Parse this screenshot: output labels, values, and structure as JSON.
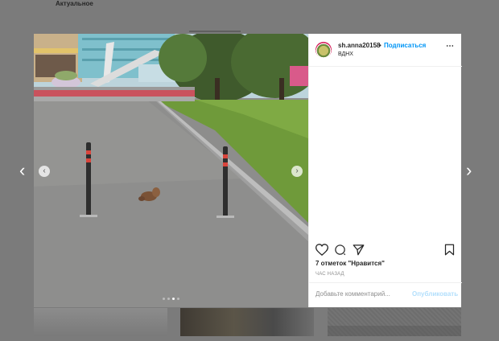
{
  "background": {
    "section_heading": "Актуальное"
  },
  "post": {
    "username": "sh.anna20158",
    "separator": "•",
    "follow_label": "Подписаться",
    "location": "ВДНХ",
    "more_icon": "⋯",
    "likes_text": "7 отметок \"Нравится\"",
    "time_ago": "ЧАС НАЗАД",
    "comment_placeholder": "Добавьте комментарий...",
    "publish_label": "Опубликовать",
    "carousel": {
      "total": 4,
      "active": 3
    }
  },
  "icons": {
    "prev": "‹",
    "next": "›",
    "outer_prev": "‹",
    "outer_next": "›"
  },
  "colors": {
    "overlay": "#7b7b7b",
    "link_blue": "#0095f6",
    "publish_disabled": "#b2dffc",
    "text": "#262626",
    "muted": "#8e8e8e"
  }
}
